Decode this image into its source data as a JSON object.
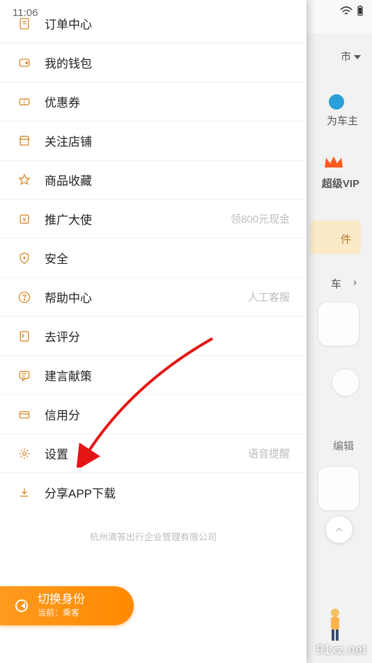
{
  "status": {
    "time": "11:06"
  },
  "bg": {
    "city": "市",
    "become_owner": "为车主",
    "super_vip": "超级VIP",
    "something": "件",
    "car": "车",
    "edit": "编辑"
  },
  "menu": {
    "items": [
      {
        "icon": "order-icon",
        "label": "订单中心",
        "extra": ""
      },
      {
        "icon": "wallet-icon",
        "label": "我的钱包",
        "extra": ""
      },
      {
        "icon": "coupon-icon",
        "label": "优惠券",
        "extra": ""
      },
      {
        "icon": "shop-icon",
        "label": "关注店铺",
        "extra": ""
      },
      {
        "icon": "favorite-icon",
        "label": "商品收藏",
        "extra": ""
      },
      {
        "icon": "promo-icon",
        "label": "推广大使",
        "extra": "领800元现金"
      },
      {
        "icon": "shield-icon",
        "label": "安全",
        "extra": ""
      },
      {
        "icon": "help-icon",
        "label": "帮助中心",
        "extra": "人工客服"
      },
      {
        "icon": "rate-icon",
        "label": "去评分",
        "extra": ""
      },
      {
        "icon": "feedback-icon",
        "label": "建言献策",
        "extra": ""
      },
      {
        "icon": "credit-icon",
        "label": "信用分",
        "extra": ""
      },
      {
        "icon": "settings-icon",
        "label": "设置",
        "extra": "语音提醒"
      },
      {
        "icon": "download-icon",
        "label": "分享APP下载",
        "extra": ""
      }
    ]
  },
  "footer": {
    "company": "杭州滴答出行企业管理有限公司"
  },
  "switch": {
    "title": "切换身份",
    "current": "当前：乘客"
  },
  "watermark": "91xz.net"
}
